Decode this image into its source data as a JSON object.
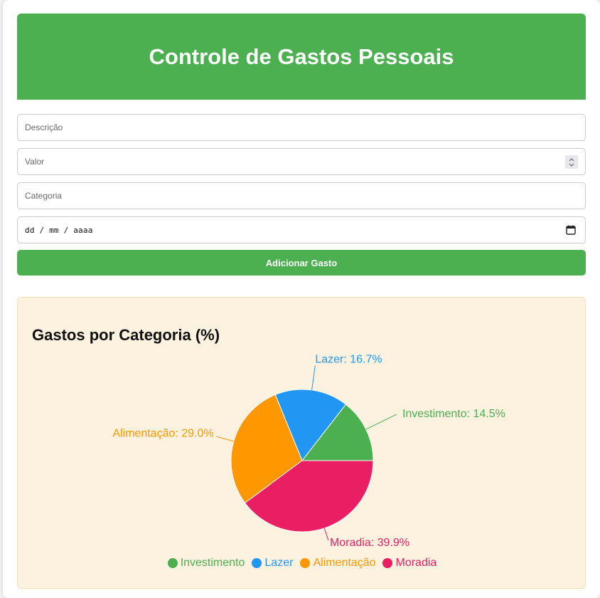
{
  "header": {
    "title": "Controle de Gastos Pessoais"
  },
  "form": {
    "description_placeholder": "Descrição",
    "value_placeholder": "Valor",
    "category_placeholder": "Categoria",
    "date_placeholder": "dd / mm / aaaa",
    "submit_label": "Adicionar Gasto"
  },
  "colors": {
    "accent": "#4caf50",
    "chart_bg": "#fdf1df",
    "Investimento": "#4caf50",
    "Lazer": "#2196f3",
    "Alimentação": "#ff9800",
    "Moradia": "#e91e63"
  },
  "chart_data": {
    "type": "pie",
    "title": "Gastos por Categoria (%)",
    "categories": [
      "Investimento",
      "Lazer",
      "Alimentação",
      "Moradia"
    ],
    "values": [
      14.5,
      16.7,
      29.0,
      39.9
    ],
    "labels": [
      "Investimento: 14.5%",
      "Lazer: 16.7%",
      "Alimentação: 29.0%",
      "Moradia: 39.9%"
    ],
    "legend_position": "bottom"
  }
}
